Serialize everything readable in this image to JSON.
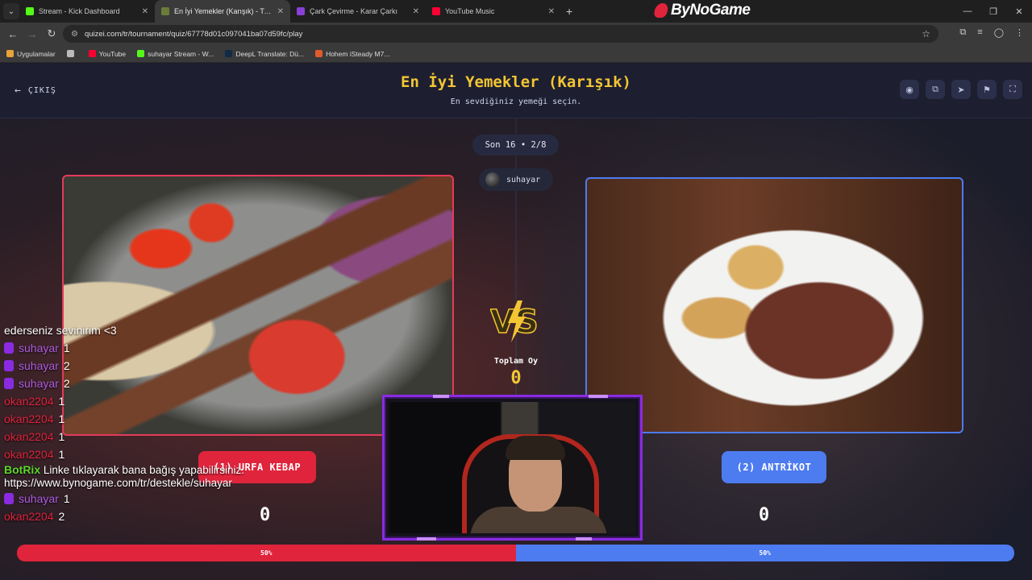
{
  "browser": {
    "tabs": [
      {
        "title": "Stream - Kick Dashboard",
        "fav": "#53fc18",
        "active": false
      },
      {
        "title": "En İyi Yemekler (Karışık) - Tier L",
        "fav": "#6b7c3a",
        "active": true
      },
      {
        "title": "Çark Çevirme - Karar Çarkı",
        "fav": "#8a3fd6",
        "active": false
      },
      {
        "title": "YouTube Music",
        "fav": "#ff0033",
        "active": false
      }
    ],
    "brand": "ByNoGame",
    "url": "quizei.com/tr/tournament/quiz/67778d01c097041ba07d59fc/play",
    "bookmarks": [
      {
        "label": "Uygulamalar",
        "fav": "#e8a33a"
      },
      {
        "label": "",
        "fav": "#bbbbbb"
      },
      {
        "label": "YouTube",
        "fav": "#ff0033"
      },
      {
        "label": "suhayar Stream - W...",
        "fav": "#53fc18"
      },
      {
        "label": "DeepL Translate: Dü...",
        "fav": "#0f2b46"
      },
      {
        "label": "Hohem iSteady M7...",
        "fav": "#e05a2b"
      }
    ]
  },
  "page": {
    "exit_label": "ÇIKIŞ",
    "title": "En İyi Yemekler (Karışık)",
    "subtitle": "En sevdiğiniz yemeği seçin.",
    "round": "Son 16 • 2/8",
    "username": "suhayar",
    "votes_label": "Toplam Oy",
    "votes_total": "0",
    "left": {
      "label": "(1) URFA KEBAP",
      "score": "0",
      "percent": "50%",
      "color": "#e0243c"
    },
    "right": {
      "label": "(2) ANTRİKOT",
      "score": "0",
      "percent": "50%",
      "color": "#4d7bf0"
    }
  },
  "chat": [
    {
      "user": "",
      "num": "",
      "text": "ederseniz sevinirim <3",
      "style": "plain"
    },
    {
      "user": "suhayar",
      "num": "1",
      "style": "purple"
    },
    {
      "user": "suhayar",
      "num": "2",
      "style": "purple"
    },
    {
      "user": "suhayar",
      "num": "2",
      "style": "purple"
    },
    {
      "user": "okan2204",
      "num": "1",
      "style": "red"
    },
    {
      "user": "okan2204",
      "num": "1",
      "style": "red"
    },
    {
      "user": "okan2204",
      "num": "1",
      "style": "red"
    },
    {
      "user": "okan2204",
      "num": "1",
      "style": "red"
    },
    {
      "user": "BotRix",
      "text": "Linke tıklayarak bana bağış yapabilirsiniz. https://www.bynogame.com/tr/destekle/suhayar",
      "style": "bot"
    },
    {
      "user": "suhayar",
      "num": "1",
      "style": "purple"
    },
    {
      "user": "okan2204",
      "num": "2",
      "style": "red"
    }
  ]
}
